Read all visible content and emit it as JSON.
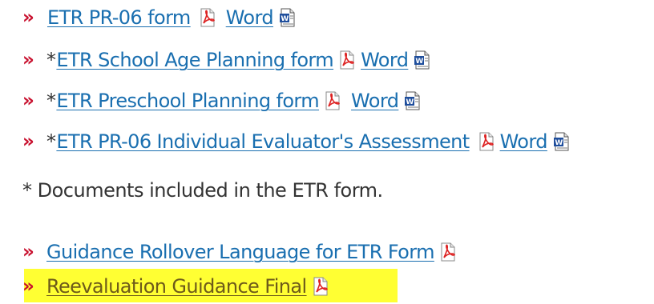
{
  "colors": {
    "bullet": "#c8102e",
    "link": "#1a6fb0",
    "highlight": "#ffff33",
    "text": "#333333"
  },
  "bullet_glyph": "»",
  "items": [
    {
      "star": "",
      "link": "ETR PR-06 form",
      "word": "Word"
    },
    {
      "star": "*",
      "link": "ETR School Age Planning form",
      "word": "Word"
    },
    {
      "star": "*",
      "link": "ETR Preschool Planning form",
      "word": "Word"
    },
    {
      "star": "*",
      "link": "ETR PR-06 Individual Evaluator's Assessment",
      "word": "Word"
    }
  ],
  "note": "* Documents included in the ETR form.",
  "guidance": [
    {
      "link": "Guidance Rollover Language for ETR Form"
    },
    {
      "link": "Reevaluation Guidance Final",
      "highlighted": true
    }
  ],
  "icons": {
    "pdf": "pdf-icon",
    "word": "word-icon"
  }
}
